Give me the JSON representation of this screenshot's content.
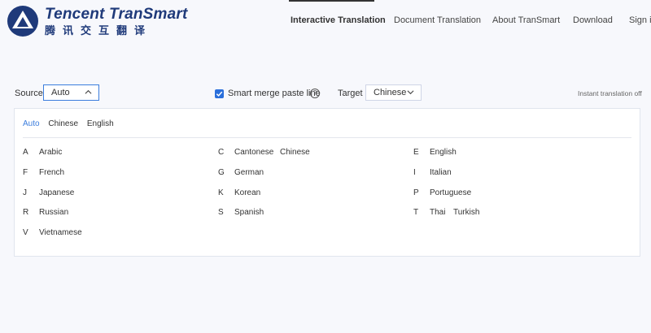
{
  "header": {
    "logo_en": "Tencent TranSmart",
    "logo_zh": "腾讯交互翻译",
    "nav": [
      {
        "label": "Interactive Translation",
        "active": true
      },
      {
        "label": "Document Translation"
      },
      {
        "label": "About TranSmart"
      },
      {
        "label": "Download"
      },
      {
        "label": "Sign in"
      }
    ]
  },
  "controls": {
    "source_label": "Source",
    "source_value": "Auto",
    "smart_merge_label": "Smart merge paste line",
    "smart_merge_checked": true,
    "target_label": "Target",
    "target_value": "Chinese",
    "instant_label": "Instant translation off"
  },
  "dropdown": {
    "quick": [
      "Auto",
      "Chinese",
      "English"
    ],
    "quick_selected": "Auto",
    "columns": [
      [
        {
          "letter": "A",
          "langs": [
            "Arabic"
          ]
        },
        {
          "letter": "F",
          "langs": [
            "French"
          ]
        },
        {
          "letter": "J",
          "langs": [
            "Japanese"
          ]
        },
        {
          "letter": "R",
          "langs": [
            "Russian"
          ]
        },
        {
          "letter": "V",
          "langs": [
            "Vietnamese"
          ]
        }
      ],
      [
        {
          "letter": "C",
          "langs": [
            "Cantonese",
            "Chinese"
          ]
        },
        {
          "letter": "G",
          "langs": [
            "German"
          ]
        },
        {
          "letter": "K",
          "langs": [
            "Korean"
          ]
        },
        {
          "letter": "S",
          "langs": [
            "Spanish"
          ]
        }
      ],
      [
        {
          "letter": "E",
          "langs": [
            "English"
          ]
        },
        {
          "letter": "I",
          "langs": [
            "Italian"
          ]
        },
        {
          "letter": "P",
          "langs": [
            "Portuguese"
          ]
        },
        {
          "letter": "T",
          "langs": [
            "Thai",
            "Turkish"
          ]
        }
      ]
    ]
  },
  "colors": {
    "accent": "#3b7ddd",
    "brand": "#1f3a7a",
    "checkbox": "#2a6fdb"
  }
}
